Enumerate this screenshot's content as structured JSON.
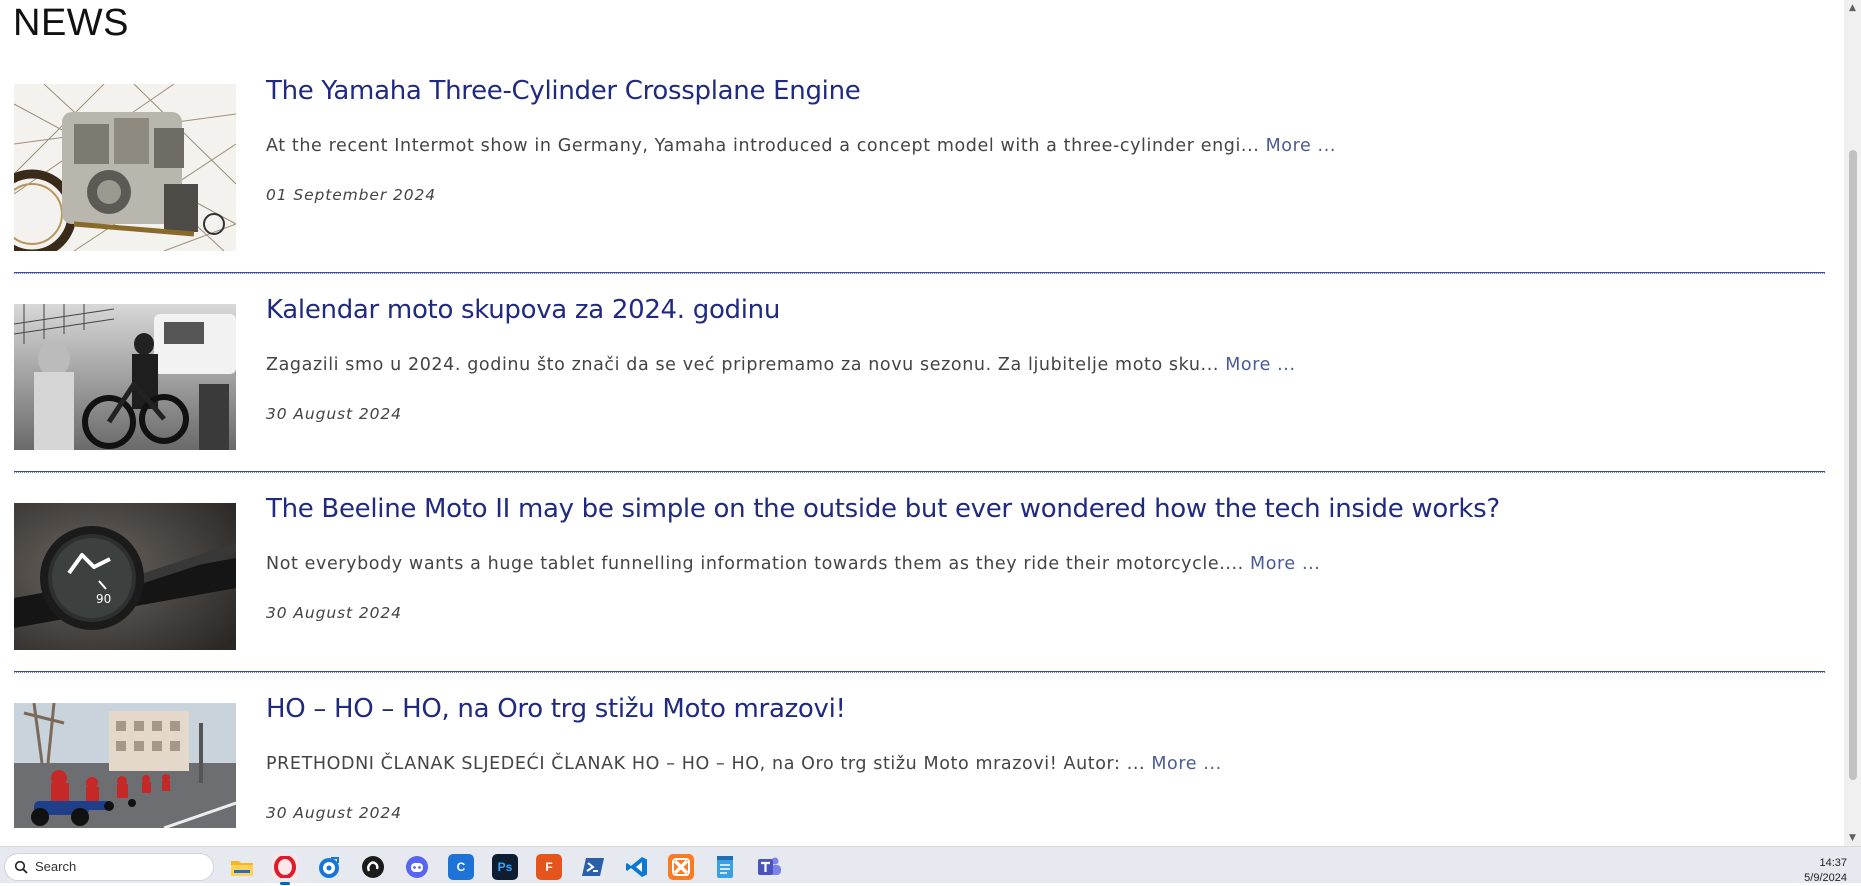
{
  "page": {
    "title": "NEWS"
  },
  "articles": [
    {
      "title": "The Yamaha Three-Cylinder Crossplane Engine",
      "excerpt": "At the recent Intermot show in Germany, Yamaha introduced a concept model with a three-cylinder engi...",
      "more_label": "More ...",
      "date": "01 September 2024",
      "image": "engine-motorcycle-illustration"
    },
    {
      "title": "Kalendar moto skupova za 2024. godinu",
      "excerpt": "Zagazili smo u 2024. godinu što znači da se već pripremamo za novu sezonu. Za ljubitelje moto sku...",
      "more_label": "More ...",
      "date": "30 August 2024",
      "image": "motorcycle-meeting-photo"
    },
    {
      "title": "The Beeline Moto II may be simple on the outside but ever wondered how the tech inside works?",
      "excerpt": "Not everybody wants a huge tablet funnelling information towards them as they ride their motorcycle....",
      "more_label": "More ...",
      "date": "30 August 2024",
      "image": "handlebar-navigator-device",
      "device_reading": "90"
    },
    {
      "title": "HO – HO – HO, na Oro trg stižu Moto mrazovi!",
      "excerpt": "PRETHODNI ČLANAK SLJEDEĆI ČLANAK HO – HO – HO, na Oro trg stižu Moto mrazovi! Autor: ...",
      "more_label": "More ...",
      "date": "30 August 2024",
      "image": "santa-riders-street-photo"
    }
  ],
  "taskbar": {
    "search_placeholder": "Search",
    "apps": [
      "file-explorer-icon",
      "opera-browser-icon",
      "disk-utility-icon",
      "github-icon",
      "discord-icon",
      "c-app-icon",
      "photoshop-icon",
      "filezilla-icon",
      "powershell-icon",
      "vscode-icon",
      "xampp-icon",
      "notepad-icon",
      "teams-icon"
    ],
    "time": "14:37",
    "date": "5/9/2024"
  },
  "colors": {
    "headline": "#1f2a80",
    "more_link": "#4a5a98",
    "separator": "#3a4aa8"
  }
}
